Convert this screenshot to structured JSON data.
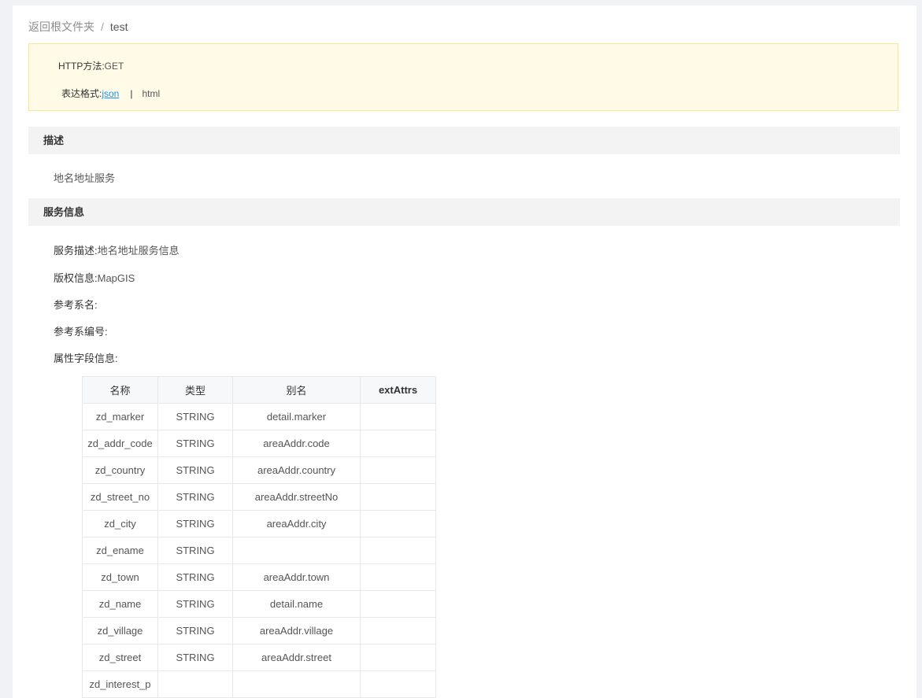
{
  "breadcrumb": {
    "root_label": "返回根文件夹",
    "separator": "/",
    "current": "test"
  },
  "info": {
    "http_method_label": "HTTP方法:",
    "http_method_value": "GET",
    "format_label": "表达格式:",
    "format_json": "json",
    "format_separator": "|",
    "format_html": "html"
  },
  "sections": {
    "description_title": "描述",
    "description_text": "地名地址服务",
    "service_info_title": "服务信息"
  },
  "service_info": {
    "desc_label": "服务描述:",
    "desc_value": "地名地址服务信息",
    "copyright_label": "版权信息:",
    "copyright_value": "MapGIS",
    "srs_name_label": "参考系名:",
    "srs_name_value": "",
    "srs_code_label": "参考系编号:",
    "srs_code_value": "",
    "fields_label": "属性字段信息:"
  },
  "table": {
    "headers": [
      "名称",
      "类型",
      "别名",
      "extAttrs"
    ],
    "rows": [
      [
        "zd_marker",
        "STRING",
        "detail.marker",
        ""
      ],
      [
        "zd_addr_code",
        "STRING",
        "areaAddr.code",
        ""
      ],
      [
        "zd_country",
        "STRING",
        "areaAddr.country",
        ""
      ],
      [
        "zd_street_no",
        "STRING",
        "areaAddr.streetNo",
        ""
      ],
      [
        "zd_city",
        "STRING",
        "areaAddr.city",
        ""
      ],
      [
        "zd_ename",
        "STRING",
        "",
        ""
      ],
      [
        "zd_town",
        "STRING",
        "areaAddr.town",
        ""
      ],
      [
        "zd_name",
        "STRING",
        "detail.name",
        ""
      ],
      [
        "zd_village",
        "STRING",
        "areaAddr.village",
        ""
      ],
      [
        "zd_street",
        "STRING",
        "areaAddr.street",
        ""
      ],
      [
        "zd_interest_p",
        "",
        "",
        ""
      ]
    ]
  }
}
